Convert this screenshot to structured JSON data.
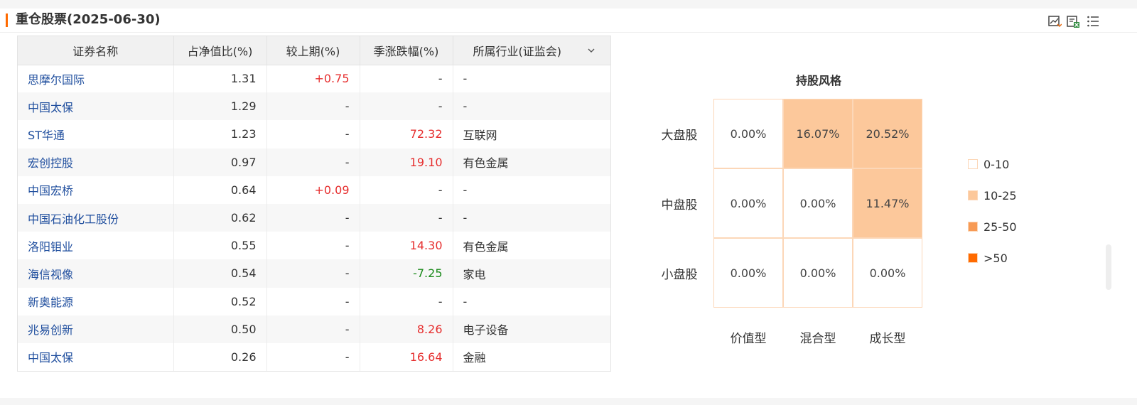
{
  "header": {
    "title": "重仓股票(2025-06-30)",
    "icons": [
      "chart-export-icon",
      "excel-export-icon",
      "list-menu-icon"
    ]
  },
  "table": {
    "columns": [
      "证券名称",
      "占净值比(%)",
      "较上期(%)",
      "季涨跌幅(%)",
      "所属行业(证监会)"
    ],
    "rows": [
      {
        "name": "思摩尔国际",
        "ratio": "1.31",
        "change": "+0.75",
        "change_color": "red",
        "quarter": "-",
        "quarter_color": "",
        "industry": "-"
      },
      {
        "name": "中国太保",
        "ratio": "1.29",
        "change": "-",
        "change_color": "",
        "quarter": "-",
        "quarter_color": "",
        "industry": "-"
      },
      {
        "name": "ST华通",
        "ratio": "1.23",
        "change": "-",
        "change_color": "",
        "quarter": "72.32",
        "quarter_color": "red",
        "industry": "互联网"
      },
      {
        "name": "宏创控股",
        "ratio": "0.97",
        "change": "-",
        "change_color": "",
        "quarter": "19.10",
        "quarter_color": "red",
        "industry": "有色金属"
      },
      {
        "name": "中国宏桥",
        "ratio": "0.64",
        "change": "+0.09",
        "change_color": "red",
        "quarter": "-",
        "quarter_color": "",
        "industry": "-"
      },
      {
        "name": "中国石油化工股份",
        "ratio": "0.62",
        "change": "-",
        "change_color": "",
        "quarter": "-",
        "quarter_color": "",
        "industry": "-"
      },
      {
        "name": "洛阳钼业",
        "ratio": "0.55",
        "change": "-",
        "change_color": "",
        "quarter": "14.30",
        "quarter_color": "red",
        "industry": "有色金属"
      },
      {
        "name": "海信视像",
        "ratio": "0.54",
        "change": "-",
        "change_color": "",
        "quarter": "-7.25",
        "quarter_color": "green",
        "industry": "家电"
      },
      {
        "name": "新奥能源",
        "ratio": "0.52",
        "change": "-",
        "change_color": "",
        "quarter": "-",
        "quarter_color": "",
        "industry": "-"
      },
      {
        "name": "兆易创新",
        "ratio": "0.50",
        "change": "-",
        "change_color": "",
        "quarter": "8.26",
        "quarter_color": "red",
        "industry": "电子设备"
      },
      {
        "name": "中国太保",
        "ratio": "0.26",
        "change": "-",
        "change_color": "",
        "quarter": "16.64",
        "quarter_color": "red",
        "industry": "金融"
      }
    ]
  },
  "style_box": {
    "title": "持股风格",
    "row_labels": [
      "大盘股",
      "中盘股",
      "小盘股"
    ],
    "col_labels": [
      "价值型",
      "混合型",
      "成长型"
    ],
    "cells": [
      [
        "0.00%",
        "16.07%",
        "20.52%"
      ],
      [
        "0.00%",
        "0.00%",
        "11.47%"
      ],
      [
        "0.00%",
        "0.00%",
        "0.00%"
      ]
    ],
    "legend": [
      {
        "label": "0-10",
        "color": "#ffffff"
      },
      {
        "label": "10-25",
        "color": "#fcc89b"
      },
      {
        "label": "25-50",
        "color": "#f79a55"
      },
      {
        "label": ">50",
        "color": "#ff6a00"
      }
    ]
  }
}
